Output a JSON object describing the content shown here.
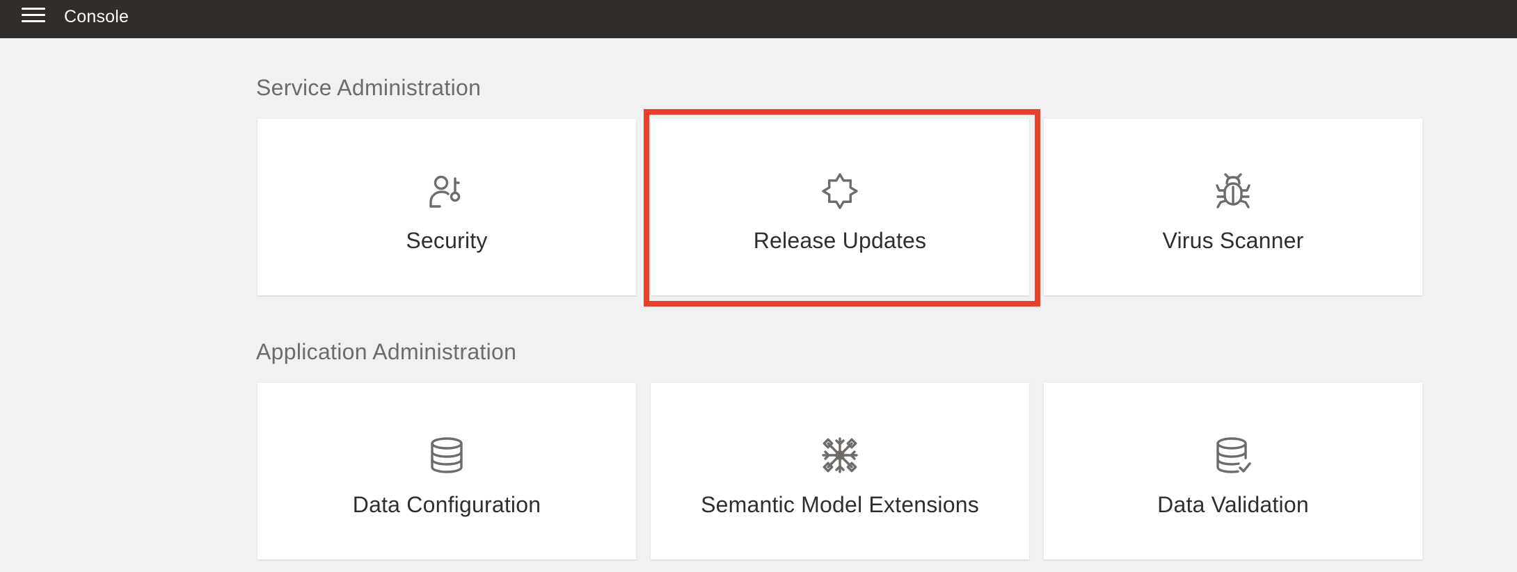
{
  "header": {
    "title": "Console",
    "menu_icon": "hamburger-menu-icon"
  },
  "sections": [
    {
      "title": "Service Administration",
      "cards": [
        {
          "label": "Security",
          "icon": "user-key-icon"
        },
        {
          "label": "Release Updates",
          "icon": "starburst-badge-icon"
        },
        {
          "label": "Virus Scanner",
          "icon": "bug-icon"
        }
      ]
    },
    {
      "title": "Application Administration",
      "cards": [
        {
          "label": "Data Configuration",
          "icon": "database-icon"
        },
        {
          "label": "Semantic Model Extensions",
          "icon": "snowflake-network-icon"
        },
        {
          "label": "Data Validation",
          "icon": "database-check-icon"
        }
      ]
    }
  ],
  "highlight": {
    "target": "Release Updates",
    "color": "#e8402b"
  },
  "colors": {
    "header_bg": "#312d2a",
    "page_bg": "#f1f1f1",
    "card_bg": "#ffffff",
    "icon": "#6e6b68"
  }
}
